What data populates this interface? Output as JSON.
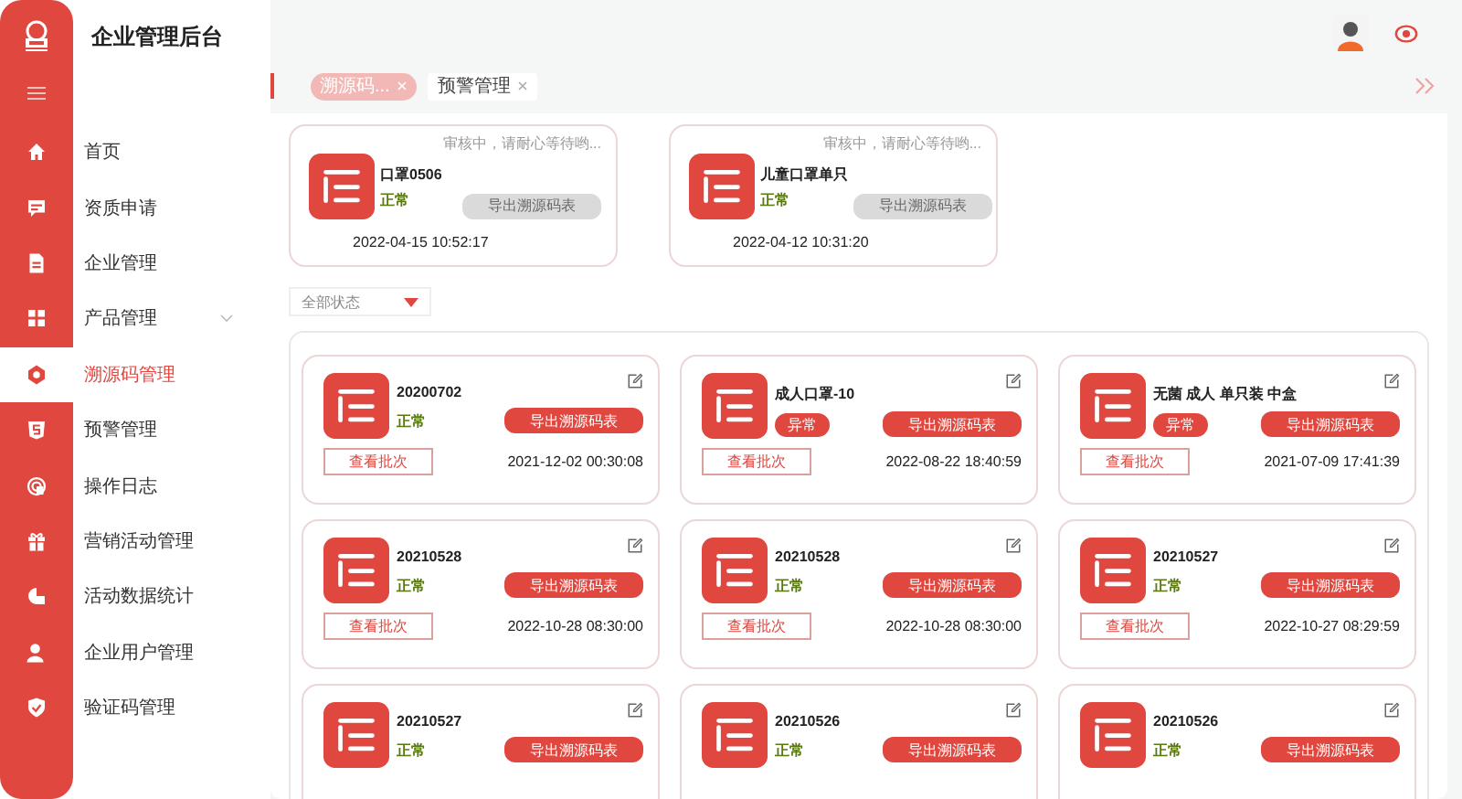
{
  "app": {
    "title": "企业管理后台"
  },
  "sidebar": {
    "items": [
      {
        "kind": "home",
        "label": "首页",
        "selected": false
      },
      {
        "kind": "chat",
        "label": "资质申请",
        "selected": false
      },
      {
        "kind": "doc",
        "label": "企业管理",
        "selected": false
      },
      {
        "kind": "grid",
        "label": "产品管理",
        "selected": false,
        "expandable": true
      },
      {
        "kind": "gear",
        "label": "溯源码管理",
        "selected": true
      },
      {
        "kind": "shield5",
        "label": "预警管理",
        "selected": false
      },
      {
        "kind": "touch",
        "label": "操作日志",
        "selected": false
      },
      {
        "kind": "gift",
        "label": "营销活动管理",
        "selected": false
      },
      {
        "kind": "pie",
        "label": "活动数据统计",
        "selected": false
      },
      {
        "kind": "user",
        "label": "企业用户管理",
        "selected": false
      },
      {
        "kind": "check",
        "label": "验证码管理",
        "selected": false
      }
    ]
  },
  "tabs": [
    {
      "label": "溯源码...",
      "selected": true
    },
    {
      "label": "预警管理",
      "selected": false
    }
  ],
  "pending_cards": [
    {
      "note": "审核中，请耐心等待哟...",
      "name": "口罩0506",
      "status": {
        "kind": "normal",
        "text": "正常"
      },
      "export_button": {
        "label": "导出溯源码表",
        "disabled": true
      },
      "date": "2022-04-15 10:52:17"
    },
    {
      "note": "审核中，请耐心等待哟...",
      "name": "儿童口罩单只",
      "status": {
        "kind": "normal",
        "text": "正常"
      },
      "export_button": {
        "label": "导出溯源码表",
        "disabled": true
      },
      "date": "2022-04-12 10:31:20"
    }
  ],
  "status_filter": {
    "value": "全部状态"
  },
  "batch_cards": [
    {
      "name": "20200702",
      "status": {
        "kind": "normal",
        "text": "正常"
      },
      "export_button": {
        "label": "导出溯源码表",
        "disabled": false
      },
      "view_button": "查看批次",
      "date": "2021-12-02 00:30:08"
    },
    {
      "name": "成人口罩-10",
      "status": {
        "kind": "abnormal",
        "text": "异常"
      },
      "export_button": {
        "label": "导出溯源码表",
        "disabled": false
      },
      "view_button": "查看批次",
      "date": "2022-08-22 18:40:59"
    },
    {
      "name": "无菌 成人 单只装 中盒",
      "status": {
        "kind": "abnormal",
        "text": "异常"
      },
      "export_button": {
        "label": "导出溯源码表",
        "disabled": false
      },
      "view_button": "查看批次",
      "date": "2021-07-09 17:41:39"
    },
    {
      "name": "20210528",
      "status": {
        "kind": "normal",
        "text": "正常"
      },
      "export_button": {
        "label": "导出溯源码表",
        "disabled": false
      },
      "view_button": "查看批次",
      "date": "2022-10-28 08:30:00"
    },
    {
      "name": "20210528",
      "status": {
        "kind": "normal",
        "text": "正常"
      },
      "export_button": {
        "label": "导出溯源码表",
        "disabled": false
      },
      "view_button": "查看批次",
      "date": "2022-10-28 08:30:00"
    },
    {
      "name": "20210527",
      "status": {
        "kind": "normal",
        "text": "正常"
      },
      "export_button": {
        "label": "导出溯源码表",
        "disabled": false
      },
      "view_button": "查看批次",
      "date": "2022-10-27 08:29:59"
    },
    {
      "name": "20210527",
      "status": {
        "kind": "normal",
        "text": "正常"
      },
      "export_button": {
        "label": "导出溯源码表",
        "disabled": false
      }
    },
    {
      "name": "20210526",
      "status": {
        "kind": "normal",
        "text": "正常"
      },
      "export_button": {
        "label": "导出溯源码表",
        "disabled": false
      }
    },
    {
      "name": "20210526",
      "status": {
        "kind": "normal",
        "text": "正常"
      },
      "export_button": {
        "label": "导出溯源码表",
        "disabled": false
      }
    }
  ]
}
